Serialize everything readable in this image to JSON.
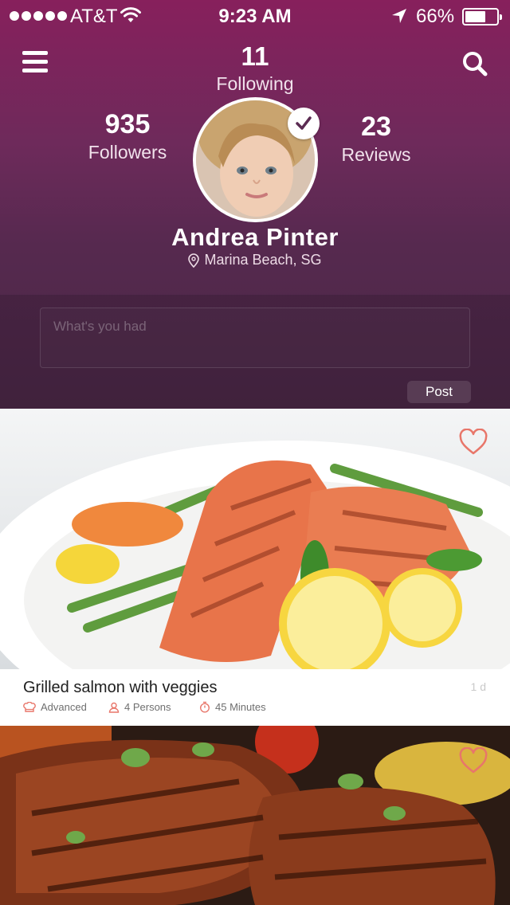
{
  "status_bar": {
    "carrier": "AT&T",
    "time": "9:23 AM",
    "battery_percent": "66%",
    "battery_level": 0.66
  },
  "profile": {
    "following_count": "11",
    "following_label": "Following",
    "followers_count": "935",
    "followers_label": "Followers",
    "reviews_count": "23",
    "reviews_label": "Reviews",
    "name": "Andrea Pinter",
    "location": "Marina Beach, SG",
    "verified": true
  },
  "composer": {
    "placeholder": "What's you had",
    "value": "",
    "post_label": "Post"
  },
  "feed": [
    {
      "title": "Grilled salmon with veggies",
      "age": "1 d",
      "difficulty": "Advanced",
      "persons": "4 Persons",
      "duration": "45 Minutes",
      "liked": false
    },
    {
      "liked": false
    }
  ],
  "colors": {
    "header_top": "#87205c",
    "header_bottom": "#4a2845",
    "accent_heart": "#e8766a",
    "title_text": "#1f1f1f",
    "meta_text": "#6f6f6f"
  },
  "icons": {
    "menu": "hamburger-icon",
    "search": "search-icon",
    "verified": "checkmark-icon",
    "location": "map-pin-icon",
    "like": "heart-icon",
    "difficulty": "chef-hat-icon",
    "persons": "person-icon",
    "duration": "stopwatch-icon"
  }
}
